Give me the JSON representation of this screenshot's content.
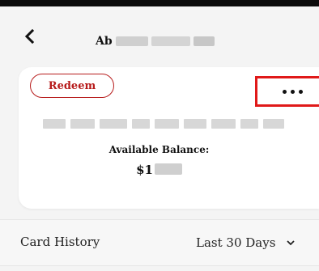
{
  "header": {
    "title_visible": "Ab",
    "back_icon": "chevron-left-icon"
  },
  "card": {
    "redeem_label": "Redeem",
    "more_icon": "more-horizontal-icon",
    "highlight_color": "#e01919",
    "accent_color": "#b71c1c",
    "balance_label": "Available Balance:",
    "balance_prefix": "$1"
  },
  "history": {
    "label": "Card History",
    "period_selected": "Last 30 Days",
    "dropdown_icon": "chevron-down-icon"
  }
}
